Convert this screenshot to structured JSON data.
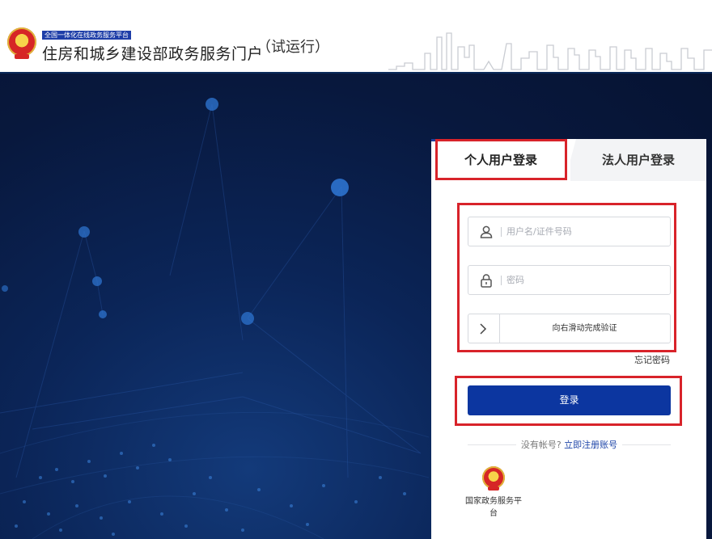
{
  "header": {
    "badge": "全国一体化在线政务服务平台",
    "title": "住房和城乡建设部政务服务门户",
    "trial": "（试运行）"
  },
  "tabs": [
    {
      "label": "个人用户登录",
      "active": true
    },
    {
      "label": "法人用户登录",
      "active": false
    }
  ],
  "form": {
    "username": {
      "value": "",
      "placeholder": "用户名/证件号码",
      "icon": "user-icon"
    },
    "password": {
      "value": "",
      "placeholder": "密码",
      "icon": "lock-icon"
    },
    "slider_text": "向右滑动完成验证",
    "forgot": "忘记密码",
    "login_button": "登录"
  },
  "register": {
    "question": "没有帐号?",
    "link": "立即注册账号"
  },
  "footer_link": {
    "label": "国家政务服务平台"
  },
  "colors": {
    "primary": "#0c36a0",
    "header_border": "#0b2a5a",
    "highlight": "#d8232a",
    "hero_bg": "#08183d"
  }
}
